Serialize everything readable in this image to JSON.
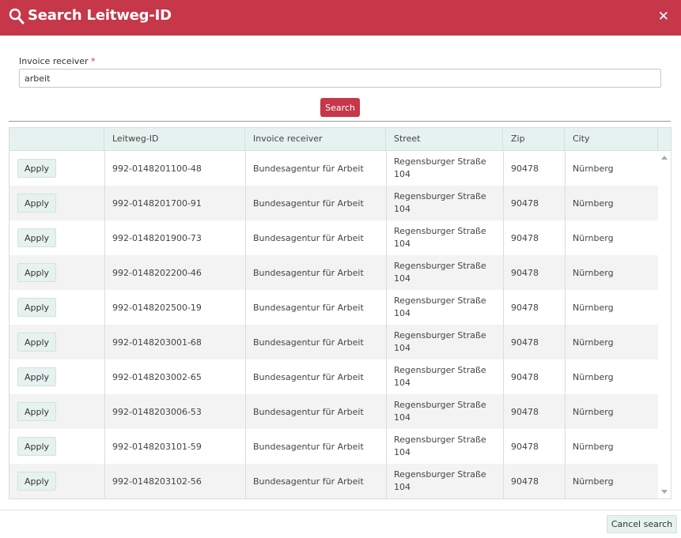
{
  "dialog": {
    "title": "Search Leitweg-ID",
    "close_glyph": "✕",
    "search_icon": "search-icon",
    "close_icon": "close-icon",
    "accent_color": "#c53749"
  },
  "form": {
    "label": "Invoice receiver",
    "required_mark": "*",
    "value": "arbeit",
    "search_label": "Search"
  },
  "table": {
    "columns": [
      "",
      "Leitweg-ID",
      "Invoice receiver",
      "Street",
      "Zip",
      "City"
    ],
    "apply_label": "Apply",
    "rows": [
      {
        "leitweg_id": "992-0148201100-48",
        "receiver": "Bundesagentur für Arbeit",
        "street": "Regensburger Straße 104",
        "zip": "90478",
        "city": "Nürnberg"
      },
      {
        "leitweg_id": "992-0148201700-91",
        "receiver": "Bundesagentur für Arbeit",
        "street": "Regensburger Straße 104",
        "zip": "90478",
        "city": "Nürnberg"
      },
      {
        "leitweg_id": "992-0148201900-73",
        "receiver": "Bundesagentur für Arbeit",
        "street": "Regensburger Straße 104",
        "zip": "90478",
        "city": "Nürnberg"
      },
      {
        "leitweg_id": "992-0148202200-46",
        "receiver": "Bundesagentur für Arbeit",
        "street": "Regensburger Straße 104",
        "zip": "90478",
        "city": "Nürnberg"
      },
      {
        "leitweg_id": "992-0148202500-19",
        "receiver": "Bundesagentur für Arbeit",
        "street": "Regensburger Straße 104",
        "zip": "90478",
        "city": "Nürnberg"
      },
      {
        "leitweg_id": "992-0148203001-68",
        "receiver": "Bundesagentur für Arbeit",
        "street": "Regensburger Straße 104",
        "zip": "90478",
        "city": "Nürnberg"
      },
      {
        "leitweg_id": "992-0148203002-65",
        "receiver": "Bundesagentur für Arbeit",
        "street": "Regensburger Straße 104",
        "zip": "90478",
        "city": "Nürnberg"
      },
      {
        "leitweg_id": "992-0148203006-53",
        "receiver": "Bundesagentur für Arbeit",
        "street": "Regensburger Straße 104",
        "zip": "90478",
        "city": "Nürnberg"
      },
      {
        "leitweg_id": "992-0148203101-59",
        "receiver": "Bundesagentur für Arbeit",
        "street": "Regensburger Straße 104",
        "zip": "90478",
        "city": "Nürnberg"
      },
      {
        "leitweg_id": "992-0148203102-56",
        "receiver": "Bundesagentur für Arbeit",
        "street": "Regensburger Straße 104",
        "zip": "90478",
        "city": "Nürnberg"
      }
    ]
  },
  "footer": {
    "cancel_label": "Cancel search"
  }
}
